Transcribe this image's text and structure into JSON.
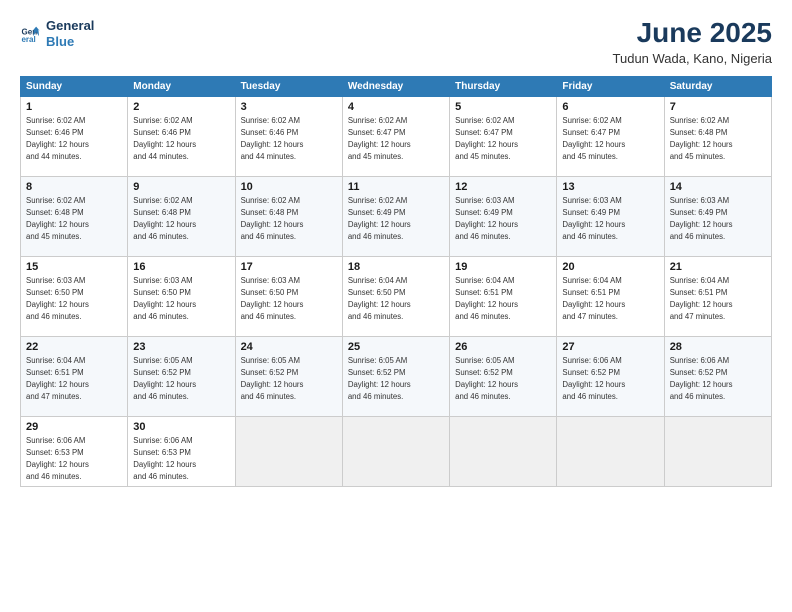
{
  "header": {
    "logo_line1": "General",
    "logo_line2": "Blue",
    "month_year": "June 2025",
    "location": "Tudun Wada, Kano, Nigeria"
  },
  "days_of_week": [
    "Sunday",
    "Monday",
    "Tuesday",
    "Wednesday",
    "Thursday",
    "Friday",
    "Saturday"
  ],
  "weeks": [
    [
      {
        "day": 1,
        "sunrise": "6:02 AM",
        "sunset": "6:46 PM",
        "daylight": "12 hours and 44 minutes."
      },
      {
        "day": 2,
        "sunrise": "6:02 AM",
        "sunset": "6:46 PM",
        "daylight": "12 hours and 44 minutes."
      },
      {
        "day": 3,
        "sunrise": "6:02 AM",
        "sunset": "6:46 PM",
        "daylight": "12 hours and 44 minutes."
      },
      {
        "day": 4,
        "sunrise": "6:02 AM",
        "sunset": "6:47 PM",
        "daylight": "12 hours and 45 minutes."
      },
      {
        "day": 5,
        "sunrise": "6:02 AM",
        "sunset": "6:47 PM",
        "daylight": "12 hours and 45 minutes."
      },
      {
        "day": 6,
        "sunrise": "6:02 AM",
        "sunset": "6:47 PM",
        "daylight": "12 hours and 45 minutes."
      },
      {
        "day": 7,
        "sunrise": "6:02 AM",
        "sunset": "6:48 PM",
        "daylight": "12 hours and 45 minutes."
      }
    ],
    [
      {
        "day": 8,
        "sunrise": "6:02 AM",
        "sunset": "6:48 PM",
        "daylight": "12 hours and 45 minutes."
      },
      {
        "day": 9,
        "sunrise": "6:02 AM",
        "sunset": "6:48 PM",
        "daylight": "12 hours and 46 minutes."
      },
      {
        "day": 10,
        "sunrise": "6:02 AM",
        "sunset": "6:48 PM",
        "daylight": "12 hours and 46 minutes."
      },
      {
        "day": 11,
        "sunrise": "6:02 AM",
        "sunset": "6:49 PM",
        "daylight": "12 hours and 46 minutes."
      },
      {
        "day": 12,
        "sunrise": "6:03 AM",
        "sunset": "6:49 PM",
        "daylight": "12 hours and 46 minutes."
      },
      {
        "day": 13,
        "sunrise": "6:03 AM",
        "sunset": "6:49 PM",
        "daylight": "12 hours and 46 minutes."
      },
      {
        "day": 14,
        "sunrise": "6:03 AM",
        "sunset": "6:49 PM",
        "daylight": "12 hours and 46 minutes."
      }
    ],
    [
      {
        "day": 15,
        "sunrise": "6:03 AM",
        "sunset": "6:50 PM",
        "daylight": "12 hours and 46 minutes."
      },
      {
        "day": 16,
        "sunrise": "6:03 AM",
        "sunset": "6:50 PM",
        "daylight": "12 hours and 46 minutes."
      },
      {
        "day": 17,
        "sunrise": "6:03 AM",
        "sunset": "6:50 PM",
        "daylight": "12 hours and 46 minutes."
      },
      {
        "day": 18,
        "sunrise": "6:04 AM",
        "sunset": "6:50 PM",
        "daylight": "12 hours and 46 minutes."
      },
      {
        "day": 19,
        "sunrise": "6:04 AM",
        "sunset": "6:51 PM",
        "daylight": "12 hours and 46 minutes."
      },
      {
        "day": 20,
        "sunrise": "6:04 AM",
        "sunset": "6:51 PM",
        "daylight": "12 hours and 47 minutes."
      },
      {
        "day": 21,
        "sunrise": "6:04 AM",
        "sunset": "6:51 PM",
        "daylight": "12 hours and 47 minutes."
      }
    ],
    [
      {
        "day": 22,
        "sunrise": "6:04 AM",
        "sunset": "6:51 PM",
        "daylight": "12 hours and 47 minutes."
      },
      {
        "day": 23,
        "sunrise": "6:05 AM",
        "sunset": "6:52 PM",
        "daylight": "12 hours and 46 minutes."
      },
      {
        "day": 24,
        "sunrise": "6:05 AM",
        "sunset": "6:52 PM",
        "daylight": "12 hours and 46 minutes."
      },
      {
        "day": 25,
        "sunrise": "6:05 AM",
        "sunset": "6:52 PM",
        "daylight": "12 hours and 46 minutes."
      },
      {
        "day": 26,
        "sunrise": "6:05 AM",
        "sunset": "6:52 PM",
        "daylight": "12 hours and 46 minutes."
      },
      {
        "day": 27,
        "sunrise": "6:06 AM",
        "sunset": "6:52 PM",
        "daylight": "12 hours and 46 minutes."
      },
      {
        "day": 28,
        "sunrise": "6:06 AM",
        "sunset": "6:52 PM",
        "daylight": "12 hours and 46 minutes."
      }
    ],
    [
      {
        "day": 29,
        "sunrise": "6:06 AM",
        "sunset": "6:53 PM",
        "daylight": "12 hours and 46 minutes."
      },
      {
        "day": 30,
        "sunrise": "6:06 AM",
        "sunset": "6:53 PM",
        "daylight": "12 hours and 46 minutes."
      },
      null,
      null,
      null,
      null,
      null
    ]
  ]
}
